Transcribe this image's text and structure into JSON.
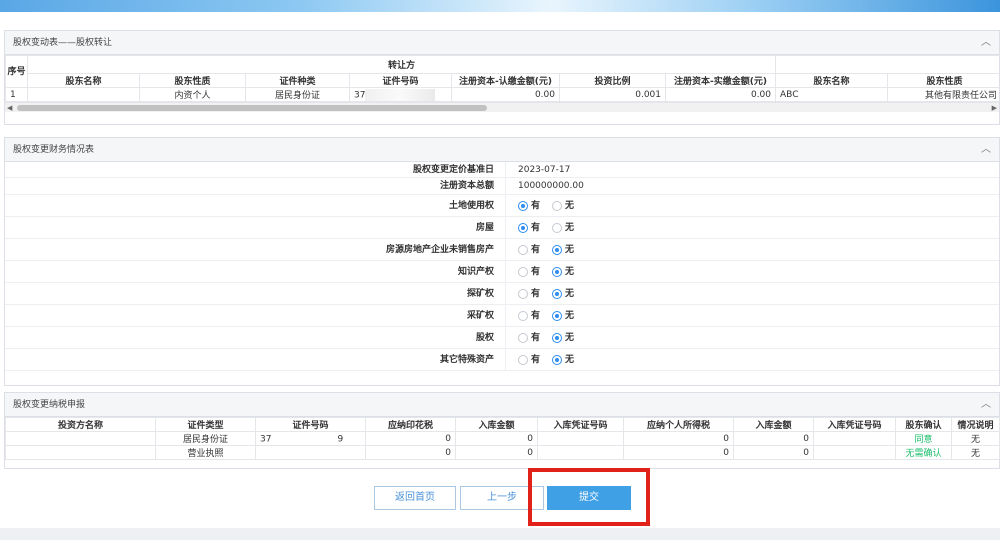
{
  "transfer": {
    "title": "股权变动表——股权转让",
    "group_header": "转让方",
    "seq_header": "序号",
    "headers": [
      "股东名称",
      "股东性质",
      "证件种类",
      "证件号码",
      "注册资本-认缴金额(元)",
      "投资比例",
      "注册资本-实缴金额(元)",
      "股东名称",
      "股东性质"
    ],
    "rows": [
      {
        "seq": "1",
        "name": "",
        "nature": "内资个人",
        "id_type": "居民身份证",
        "id_no": "37",
        "subscribed": "0.00",
        "ratio": "0.001",
        "paid": "0.00",
        "to_name": "ABC",
        "to_nature": "其他有限责任公司"
      }
    ]
  },
  "finance": {
    "title": "股权变更财务情况表",
    "yes": "有",
    "no": "无",
    "base_date_label": "股权变更定价基准日",
    "base_date": "2023-07-17",
    "capital_label": "注册资本总额",
    "capital": "100000000.00",
    "items": [
      {
        "label": "土地使用权",
        "value": "yes"
      },
      {
        "label": "房屋",
        "value": "yes"
      },
      {
        "label": "房源房地产企业未销售房产",
        "value": "no"
      },
      {
        "label": "知识产权",
        "value": "no"
      },
      {
        "label": "探矿权",
        "value": "no"
      },
      {
        "label": "采矿权",
        "value": "no"
      },
      {
        "label": "股权",
        "value": "no"
      },
      {
        "label": "其它特殊资产",
        "value": "no"
      }
    ]
  },
  "tax": {
    "title": "股权变更纳税申报",
    "headers": [
      "投资方名称",
      "证件类型",
      "证件号码",
      "应纳印花税",
      "入库金额",
      "入库凭证号码",
      "应纳个人所得税",
      "入库金额",
      "入库凭证号码",
      "股东确认",
      "情况说明"
    ],
    "rows": [
      {
        "name": "",
        "id_type": "居民身份证",
        "id_no_a": "37",
        "id_no_b": "9",
        "stamp": "0",
        "amt1": "0",
        "cert1": "",
        "iit": "0",
        "amt2": "0",
        "cert2": "",
        "confirm": "同意",
        "note": "无"
      },
      {
        "name": "",
        "id_type": "营业执照",
        "id_no_a": "",
        "id_no_b": "",
        "stamp": "0",
        "amt1": "0",
        "cert1": "",
        "iit": "0",
        "amt2": "0",
        "cert2": "",
        "confirm": "无需确认",
        "note": "无"
      }
    ]
  },
  "buttons": {
    "home": "返回首页",
    "prev": "上一步",
    "submit": "提交"
  },
  "colors": {
    "accent": "#3fa0e6",
    "confirm_green": "#19be6b",
    "highlight": "#e0221b"
  },
  "icons": {
    "collapse": "chevron-up-icon"
  }
}
